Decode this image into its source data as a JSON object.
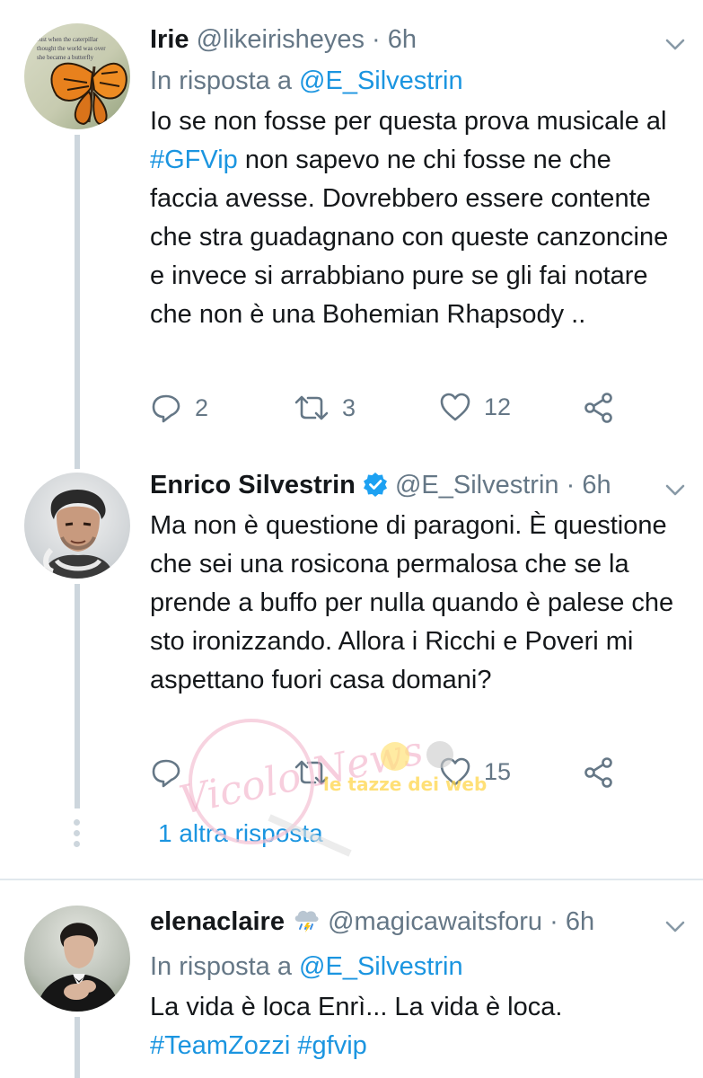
{
  "tweets": [
    {
      "name": "Irie",
      "handle": "@likeirisheyes",
      "time": "6h",
      "reply_prefix": "In risposta a ",
      "reply_to": "@E_Silvestrin",
      "text_parts": [
        "Io se non fosse per questa prova musicale al ",
        "#GFVip",
        " non sapevo ne chi fosse ne che faccia avesse. Dovrebbero essere contente che stra guadagnano con queste canzoncine e invece si arrabbiano pure se gli fai notare che non è una Bohemian Rhapsody .."
      ],
      "replies": "2",
      "retweets": "3",
      "likes": "12",
      "avatar_quote": "Just when the caterpillar thought the world was over, she became a butterfly"
    },
    {
      "name": "Enrico Silvestrin",
      "verified": true,
      "handle": "@E_Silvestrin",
      "time": "6h",
      "text": "Ma non è questione di paragoni. È questione che sei una rosicona permalosa che se la prende a buffo per nulla quando è palese che sto ironizzando. Allora i Ricchi e Poveri mi aspettano fuori casa domani?",
      "replies": "",
      "retweets": "",
      "likes": "15",
      "more_replies": "1 altra risposta"
    },
    {
      "name": "elenaclaire",
      "emoji": "cloud-rain-icon",
      "handle": "@magicawaitsforu",
      "time": "6h",
      "reply_prefix": "In risposta a ",
      "reply_to": "@E_Silvestrin",
      "text": "La vida è loca Enrì... La vida è loca.",
      "hashtags": "#TeamZozzi #gfvip"
    }
  ],
  "watermark": {
    "logo_text": "Vicolo News",
    "tagline": "le tazze dei web"
  },
  "colors": {
    "link": "#1b95e0",
    "secondary": "#657786",
    "thread": "#cdd6dd",
    "verified": "#1da1f2"
  }
}
